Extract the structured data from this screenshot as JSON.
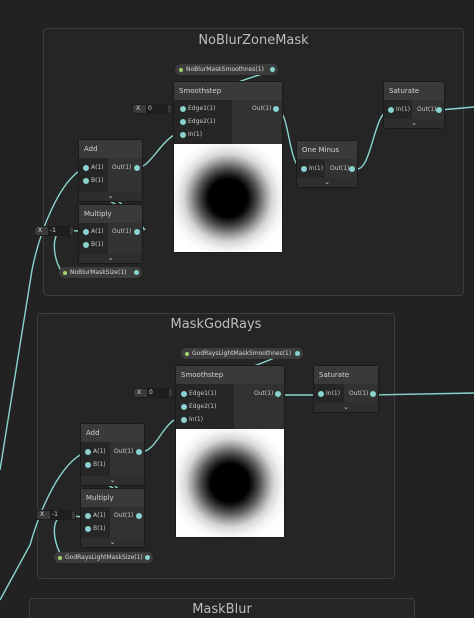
{
  "groups": {
    "noblur": {
      "title": "NoBlurZoneMask"
    },
    "godrays": {
      "title": "MaskGodRays"
    },
    "maskblur": {
      "title": "MaskBlur"
    }
  },
  "g1": {
    "prop_top": "NoBlurMaskSmoothnes(1)",
    "prop_bottom": "NoBlurMaskSize(1)",
    "smooth_x": {
      "axis": "X",
      "value": "0"
    },
    "mult_x": {
      "axis": "X",
      "value": "-1"
    },
    "smoothstep": {
      "title": "Smoothstep",
      "in1": "Edge1(1)",
      "in2": "Edge2(1)",
      "in3": "In(1)",
      "out": "Out(1)"
    },
    "add": {
      "title": "Add",
      "in1": "A(1)",
      "in2": "B(1)",
      "out": "Out(1)"
    },
    "multiply": {
      "title": "Multiply",
      "in1": "A(1)",
      "in2": "B(1)",
      "out": "Out(1)"
    },
    "oneminus": {
      "title": "One Minus",
      "in1": "In(1)",
      "out": "Out(1)"
    },
    "saturate": {
      "title": "Saturate",
      "in1": "In(1)",
      "out": "Out(1)"
    }
  },
  "g2": {
    "prop_top": "GodRaysLightMaskSmoothnes(1)",
    "prop_bottom": "GodRaysLightMaskSize(1)",
    "smooth_x": {
      "axis": "X",
      "value": "0"
    },
    "mult_x": {
      "axis": "X",
      "value": "-1"
    },
    "smoothstep": {
      "title": "Smoothstep",
      "in1": "Edge1(1)",
      "in2": "Edge2(1)",
      "in3": "In(1)",
      "out": "Out(1)"
    },
    "add": {
      "title": "Add",
      "in1": "A(1)",
      "in2": "B(1)",
      "out": "Out(1)"
    },
    "multiply": {
      "title": "Multiply",
      "in1": "A(1)",
      "in2": "B(1)",
      "out": "Out(1)"
    },
    "saturate": {
      "title": "Saturate",
      "in1": "In(1)",
      "out": "Out(1)"
    }
  },
  "icons": {
    "collapse": "⌄",
    "dropdown": "▾"
  },
  "colors": {
    "wire": "#8ad4cf",
    "port_float": "#8ad4cf",
    "property_dot": "#9fd46a"
  }
}
